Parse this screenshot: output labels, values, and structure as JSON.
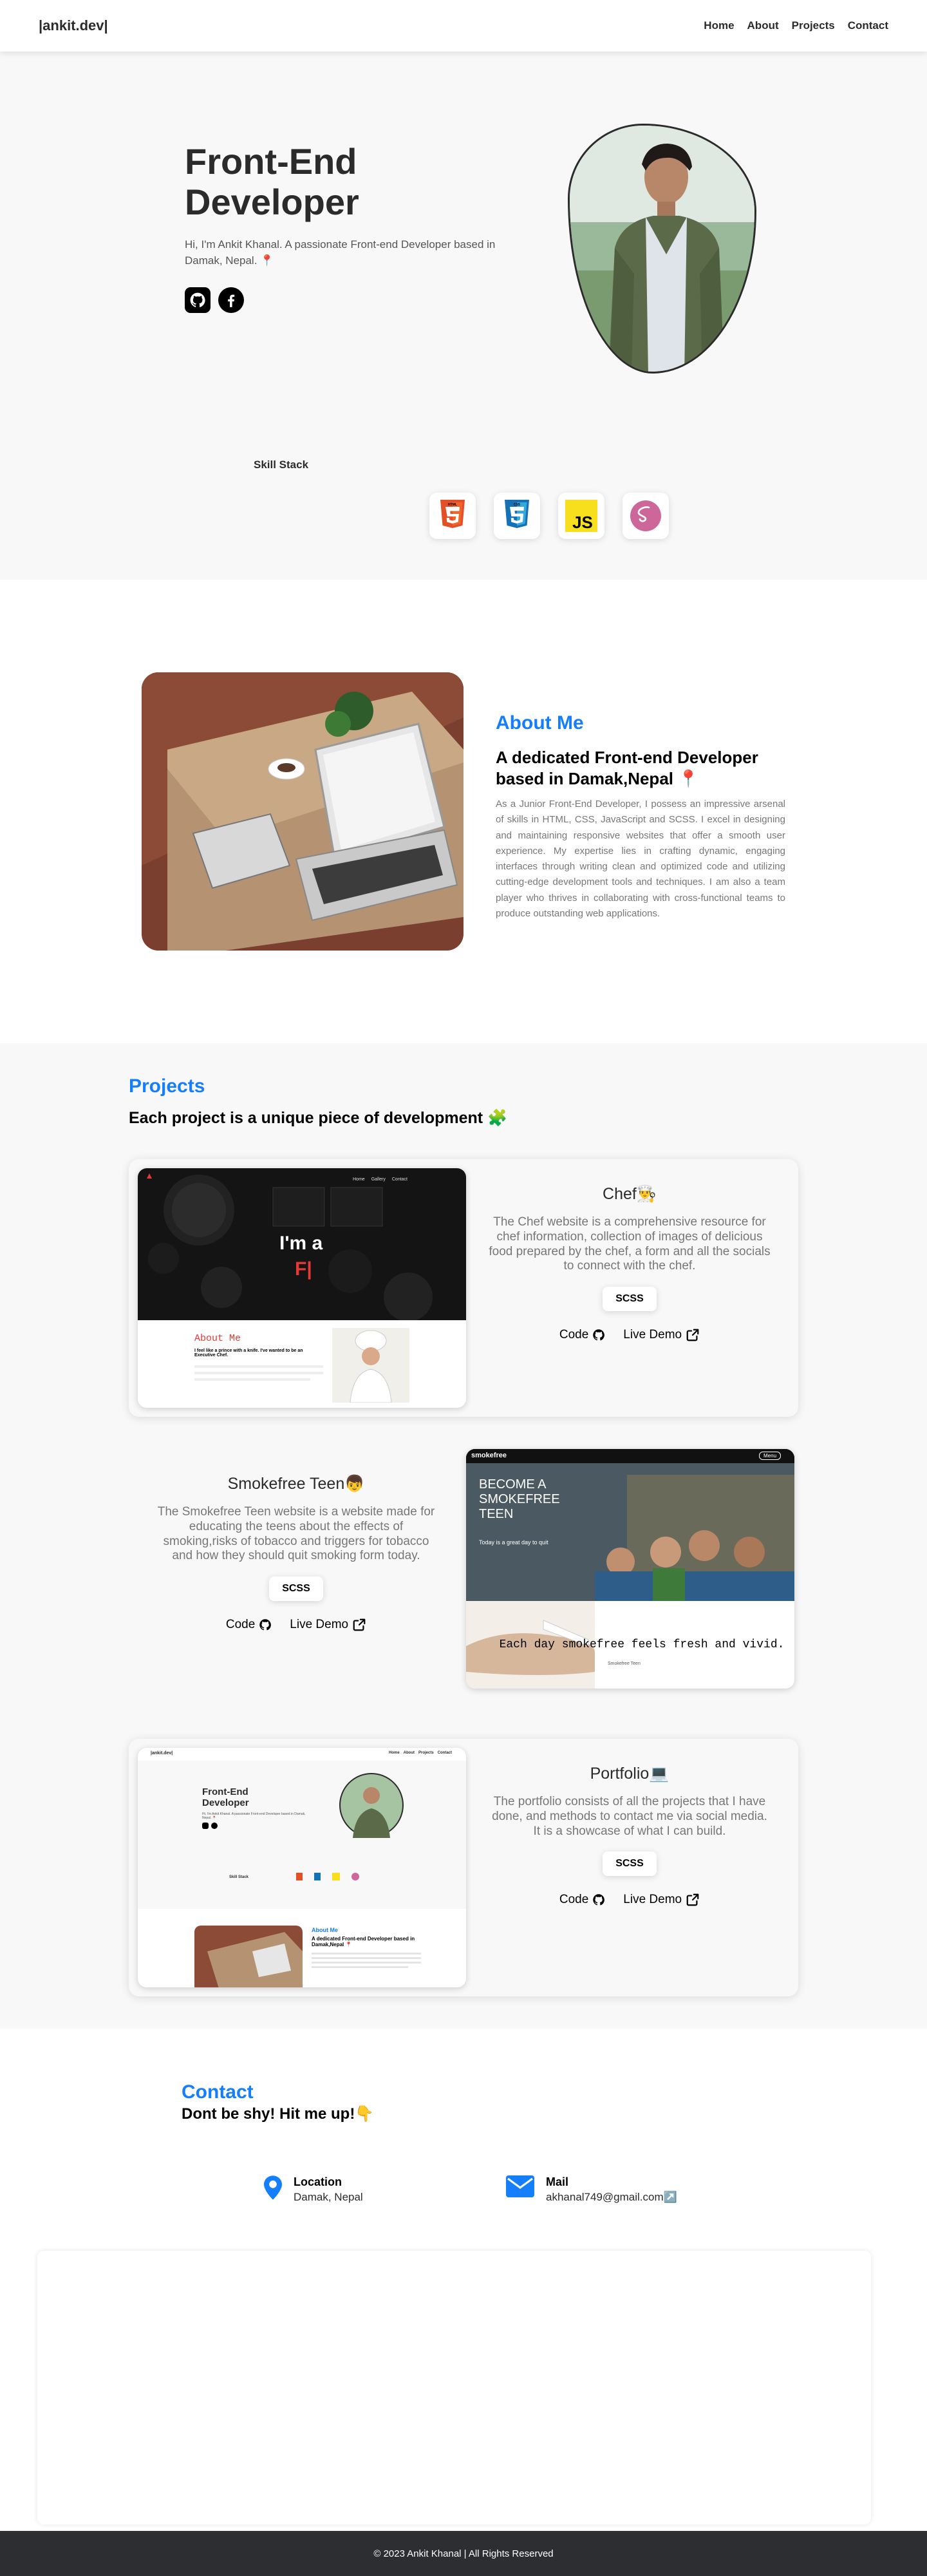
{
  "nav": {
    "brand": "|ankit.dev|",
    "links": [
      "Home",
      "About",
      "Projects",
      "Contact"
    ]
  },
  "hero": {
    "title": "Front-End Developer",
    "subtitle": "Hi, I'm Ankit Khanal. A passionate Front-end Developer based in Damak, Nepal. 📍",
    "skill_label": "Skill Stack",
    "skills": [
      {
        "name": "HTML",
        "icon": "html5-icon",
        "color": "#e34f26"
      },
      {
        "name": "CSS",
        "icon": "css3-icon",
        "color": "#1572b6"
      },
      {
        "name": "JS",
        "icon": "javascript-icon",
        "color": "#f7df1e"
      },
      {
        "name": "SASS",
        "icon": "sass-icon",
        "color": "#cd6799"
      }
    ]
  },
  "about": {
    "heading": "About Me",
    "subheading": "A dedicated Front-end Developer based in Damak,Nepal 📍",
    "text": "As a Junior Front-End Developer, I possess an impressive arsenal of skills in HTML, CSS, JavaScript and SCSS. I excel in designing and maintaining responsive websites that offer a smooth user experience. My expertise lies in crafting dynamic, engaging interfaces through writing clean and optimized code and utilizing cutting-edge development tools and techniques. I am also a team player who thrives in collaborating with cross-functional teams to produce outstanding web applications."
  },
  "projects": {
    "heading": "Projects",
    "subheading": "Each project is a unique piece of development 🧩",
    "items": [
      {
        "title": "Chef👨‍🍳",
        "desc": "The Chef website is a comprehensive resource for chef information, collection of images of delicious food prepared by the chef, a form and all the socials to connect with the chef.",
        "stack": "SCSS",
        "code": "Code",
        "demo": "Live Demo",
        "shot": {
          "nav_links": [
            "Home",
            "Gallery",
            "Contact"
          ],
          "hero_text": "I'm a",
          "hero_text2": "F|",
          "about_title": "About  Me",
          "about_sub": "I feel like a prince with a knife. I've wanted to be an Executive Chef."
        }
      },
      {
        "title": "Smokefree Teen👦",
        "desc": "The Smokefree Teen website is a website made for educating the teens about the effects of smoking,risks of tobacco and triggers for tobacco and how they should quit smoking form today.",
        "stack": "SCSS",
        "code": "Code",
        "demo": "Live Demo",
        "shot": {
          "brand": "smokefree",
          "menu": "Menu",
          "headline": "BECOME A SMOKEFREE TEEN",
          "tagline": "Today is a great day to quit",
          "quote": "Each day smokefree feels fresh and vivid.",
          "quote_by": "Smokefree Teen"
        }
      },
      {
        "title": "Portfolio💻",
        "desc": "The portfolio consists of all the projects that I have done, and methods to contact me via social media. It is a showcase of what I can build.",
        "stack": "SCSS",
        "code": "Code",
        "demo": "Live Demo",
        "shot": {
          "brand": "|ankit.dev|",
          "nav_links": [
            "Home",
            "About",
            "Projects",
            "Contact"
          ],
          "title": "Front-End Developer",
          "sub": "Hi, I'm Ankit Khanal. A passionate Front-end Developer based in Damak, Nepal. 📍",
          "skill_label": "Skill Stack",
          "about_h": "About Me",
          "about_sub": "A dedicated Front-end Developer based in Damak,Nepal 📍"
        }
      }
    ]
  },
  "contact": {
    "heading": "Contact",
    "subheading": "Dont be shy! Hit me up!👇",
    "location_label": "Location",
    "location_value": "Damak, Nepal",
    "mail_label": "Mail",
    "mail_value": "akhanal749@gmail.com↗️"
  },
  "footer": {
    "text": "© 2023 Ankit Khanal | All Rights Reserved"
  },
  "colors": {
    "accent": "#147efb",
    "footer_bg": "#2d2e32",
    "section_bg": "#f8f8f8"
  }
}
